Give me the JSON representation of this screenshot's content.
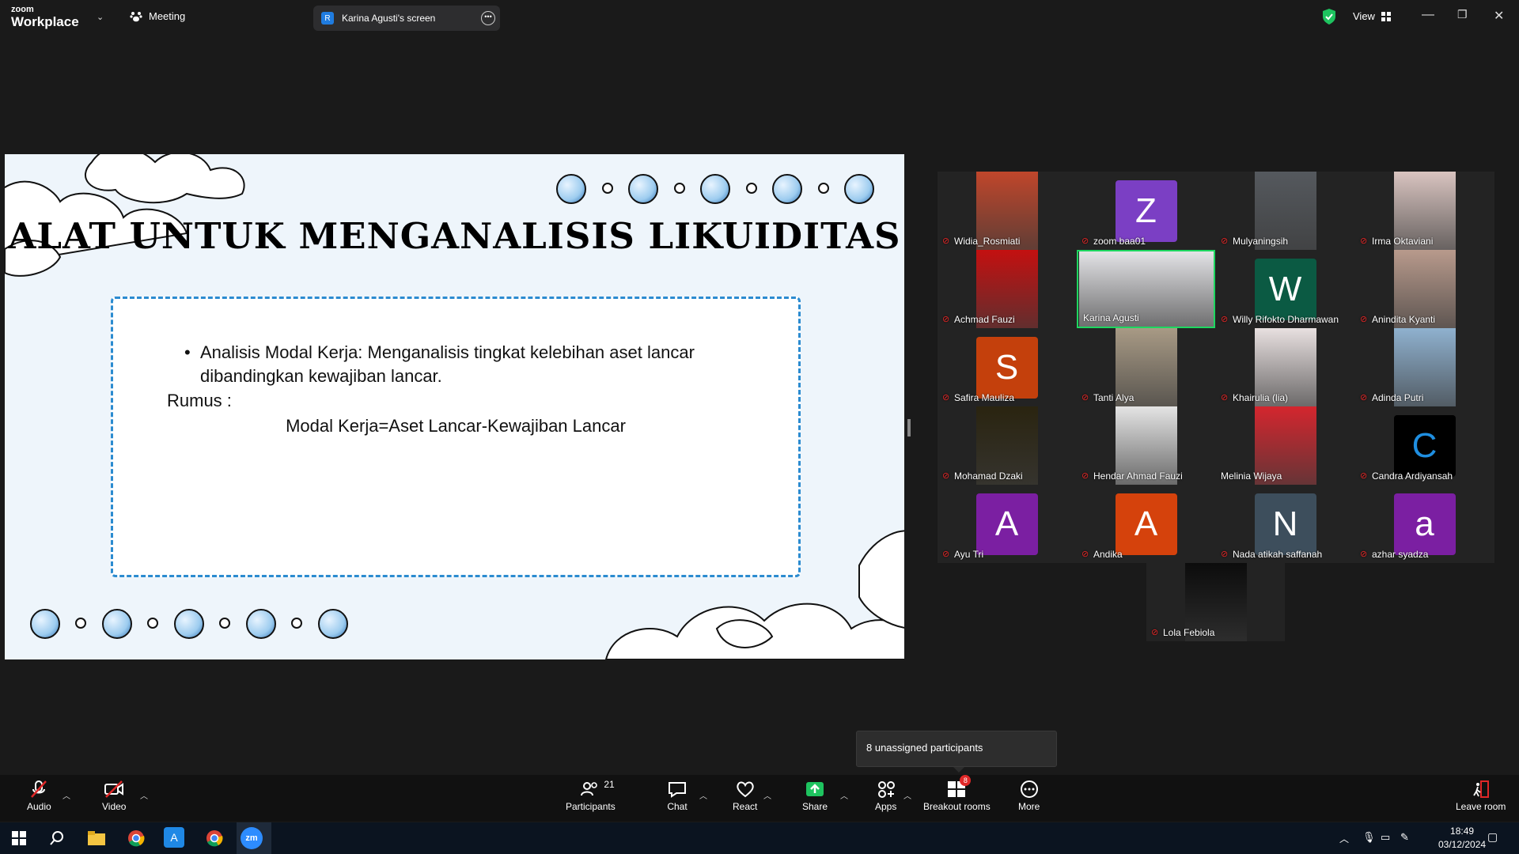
{
  "app": {
    "brand_top": "zoom",
    "brand_bottom": "Workplace",
    "meeting_label": "Meeting",
    "shared_screen_badge": "R",
    "shared_screen_label": "Karina Agusti's screen",
    "view_label": "View"
  },
  "slide": {
    "title": "ALAT UNTUK MENGANALISIS LIKUIDITAS",
    "bullet": "Analisis Modal Kerja: Menganalisis tingkat kelebihan aset lancar dibandingkan kewajiban lancar.",
    "rumus_label": "Rumus :",
    "formula": "Modal Kerja=Aset Lancar-Kewajiban Lancar"
  },
  "participants": [
    {
      "name": "Widia_Rosmiati",
      "kind": "photo",
      "color": "#c0462b",
      "muted": true
    },
    {
      "name": "zoom baa01",
      "kind": "letter",
      "letter": "Z",
      "color": "#7b3fc4",
      "muted": true
    },
    {
      "name": "Mulyaningsih",
      "kind": "photo",
      "color": "#55595e",
      "muted": true
    },
    {
      "name": "Irma Oktaviani",
      "kind": "photo",
      "color": "#d9c4c0",
      "muted": true
    },
    {
      "name": "Achmad Fauzi",
      "kind": "photo",
      "color": "#c41010",
      "muted": true
    },
    {
      "name": "Karina Agusti",
      "kind": "photo",
      "color": "#e3e3e6",
      "muted": false,
      "active": true
    },
    {
      "name": "Willy Rifokto Dharmawan",
      "kind": "letter",
      "letter": "W",
      "color": "#0b5a43",
      "muted": true
    },
    {
      "name": "Anindita Kyanti",
      "kind": "photo",
      "color": "#b89a8c",
      "muted": true
    },
    {
      "name": "Safira Mauliza",
      "kind": "letter",
      "letter": "S",
      "color": "#c4400c",
      "muted": true
    },
    {
      "name": "Tanti Alya",
      "kind": "photo",
      "color": "#a89a85",
      "muted": true
    },
    {
      "name": "Khairulia (lia)",
      "kind": "photo",
      "color": "#e8e0e0",
      "muted": true
    },
    {
      "name": "Adinda Putri",
      "kind": "photo",
      "color": "#8fb1cf",
      "muted": true
    },
    {
      "name": "Mohamad Dzaki",
      "kind": "photo",
      "color": "#2a2410",
      "muted": true
    },
    {
      "name": "Hendar Ahmad Fauzi",
      "kind": "photo",
      "color": "#e4e4e4",
      "muted": true
    },
    {
      "name": "Melinia Wijaya",
      "kind": "photo",
      "color": "#d4262e",
      "muted": false
    },
    {
      "name": "Candra Ardiyansah",
      "kind": "letter",
      "letter": "C",
      "color": "#000000",
      "letter_color": "#1f8ee0",
      "muted": true
    },
    {
      "name": "Ayu Tri",
      "kind": "letter",
      "letter": "A",
      "color": "#7b1fa2",
      "muted": true
    },
    {
      "name": "Andika",
      "kind": "letter",
      "letter": "A",
      "color": "#d5420c",
      "muted": true
    },
    {
      "name": "Nada atikah saffanah",
      "kind": "letter",
      "letter": "N",
      "color": "#3d4e5c",
      "muted": true
    },
    {
      "name": "azhar syadza",
      "kind": "letter",
      "letter": "a",
      "color": "#7b1fa2",
      "muted": true
    },
    {
      "name": "Lola Febiola",
      "kind": "photo",
      "color": "#0c0c0c",
      "muted": true
    }
  ],
  "tooltip": "8 unassigned participants",
  "toolbar": {
    "audio": "Audio",
    "video": "Video",
    "participants": "Participants",
    "participants_count": "21",
    "chat": "Chat",
    "react": "React",
    "share": "Share",
    "apps": "Apps",
    "breakout": "Breakout rooms",
    "breakout_badge": "8",
    "more": "More",
    "leave": "Leave room"
  },
  "taskbar": {
    "time": "18:49",
    "date": "03/12/2024"
  },
  "colors": {
    "accent": "#0b5cff",
    "share": "#1ec35f",
    "mute": "#e02828",
    "active_speaker": "#1ed760"
  }
}
